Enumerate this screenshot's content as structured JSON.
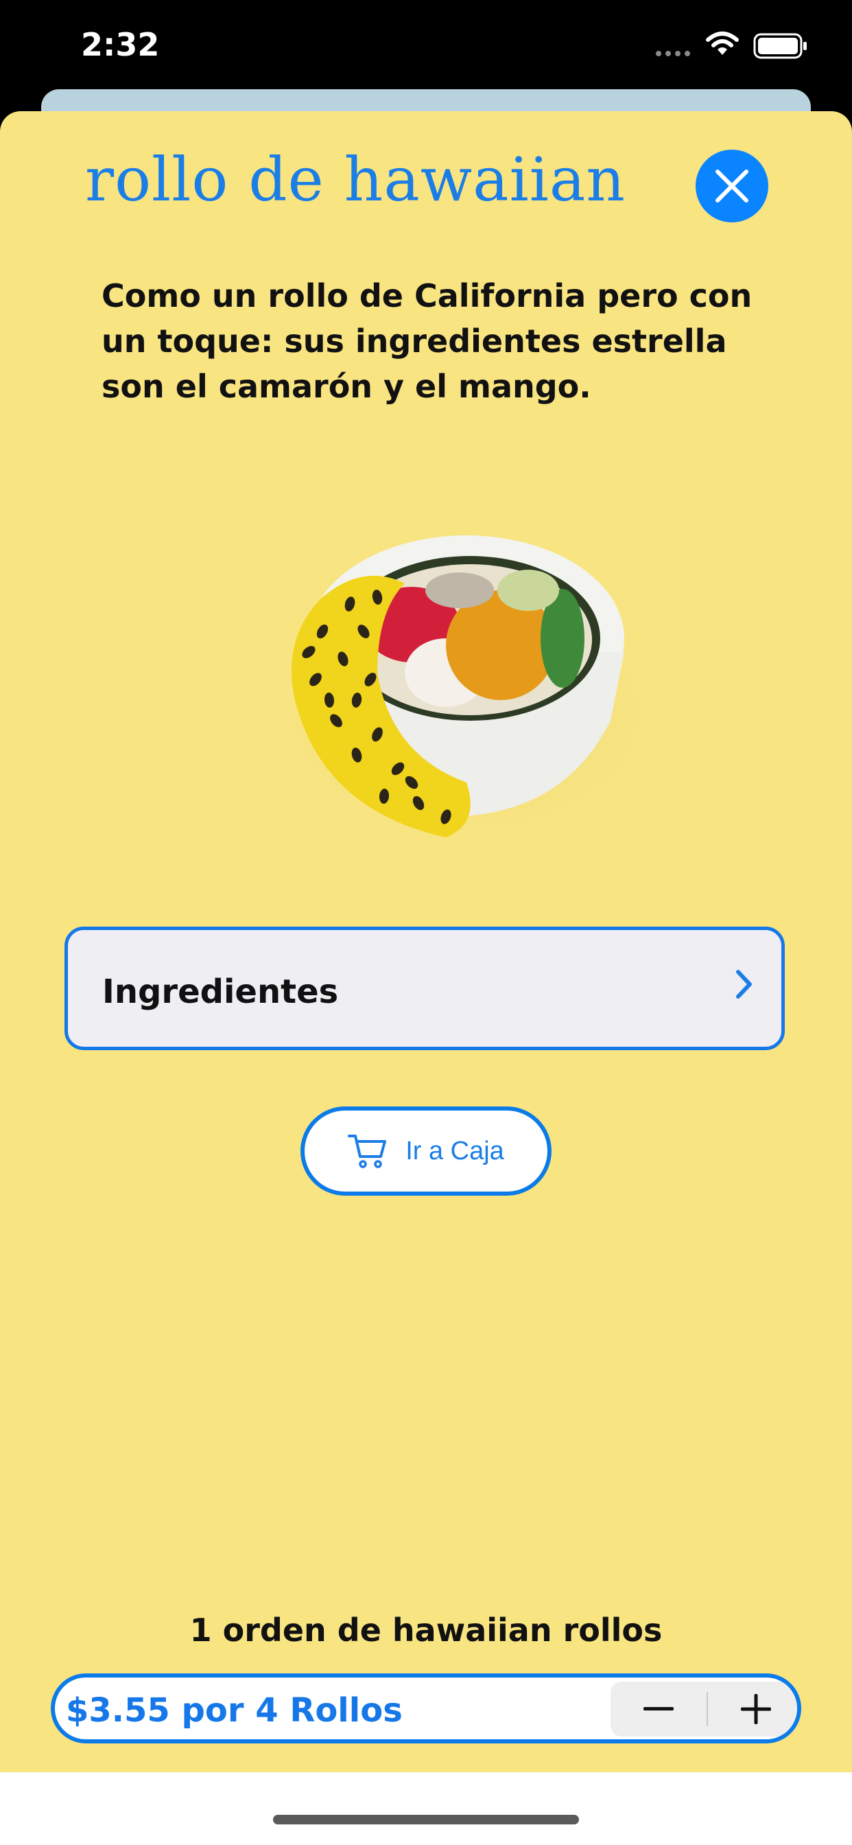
{
  "status_bar": {
    "time": "2:32"
  },
  "product": {
    "title": "rollo de hawaiian",
    "description": "Como un rollo de California pero con un toque: sus ingredientes estrella son el camarón y el mango."
  },
  "ingredients": {
    "label": "Ingredientes"
  },
  "checkout": {
    "label": "Ir a Caja"
  },
  "order": {
    "summary": "1 orden de hawaiian rollos",
    "price_label": "$3.55 por 4 Rollos",
    "quantity": 1
  },
  "icons": {
    "close": "close-icon",
    "chevron": "chevron-right-icon",
    "cart": "cart-icon",
    "minus": "minus-icon",
    "plus": "plus-icon"
  },
  "colors": {
    "accent": "#0a84ff",
    "sheet_background": "#f9e482",
    "text": "#111111"
  }
}
